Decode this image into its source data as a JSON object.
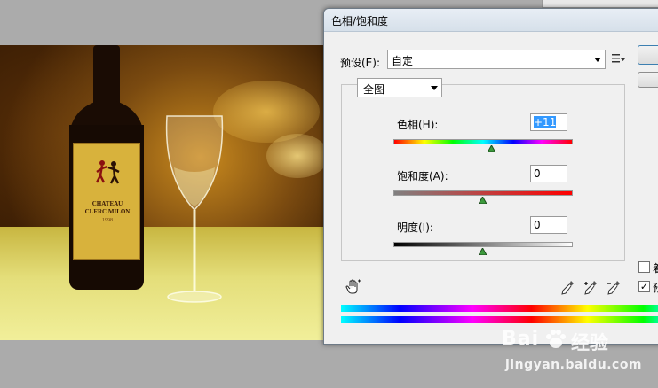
{
  "dialog": {
    "title": "色相/饱和度",
    "preset_label": "预设(E):",
    "preset_value": "自定",
    "channel_value": "全图",
    "hue": {
      "label": "色相(H):",
      "value": "+11",
      "level": 11
    },
    "saturation": {
      "label": "饱和度(A):",
      "value": "0",
      "level": 0
    },
    "lightness": {
      "label": "明度(I):",
      "value": "0",
      "level": 0
    },
    "colorize_label": "着",
    "preview_label": "预",
    "preview_checked": "✓"
  },
  "photo": {
    "label_line1": "CHATEAU",
    "label_line2": "CLERC MILON",
    "label_line3": "1998"
  },
  "watermark": {
    "brand": "Bai",
    "brand_tail": "经验",
    "url": "jingyan.baidu.com"
  },
  "colors": {
    "dialog_bg": "#f0f0f0",
    "selection": "#3399ff",
    "workspace": "#ababab"
  }
}
